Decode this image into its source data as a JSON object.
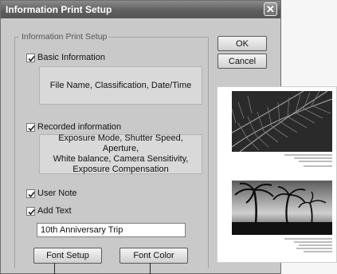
{
  "window": {
    "title": "Information Print Setup",
    "close_glyph": "✕"
  },
  "group": {
    "label": "Information Print Setup"
  },
  "buttons": {
    "ok": "OK",
    "cancel": "Cancel",
    "font_setup": "Font Setup",
    "font_color": "Font Color"
  },
  "options": {
    "basic": {
      "label": "Basic Information",
      "checked": true,
      "details": "File Name, Classification, Date/Time"
    },
    "recorded": {
      "label": "Recorded information",
      "checked": true,
      "details_lines": [
        "Exposure Mode, Shutter Speed, Aperture,",
        "White balance, Camera Sensitivity,",
        "Exposure Compensation"
      ]
    },
    "user_note": {
      "label": "User Note",
      "checked": true
    },
    "add_text": {
      "label": "Add Text",
      "checked": true,
      "value": "10th Anniversary Trip"
    }
  },
  "icons": {
    "checkmark": "check-icon",
    "close": "close-icon"
  },
  "colors": {
    "titlebar": "#5f5f5f",
    "dialog_bg": "#c9c9c9",
    "preview_bg": "#ffffff"
  }
}
